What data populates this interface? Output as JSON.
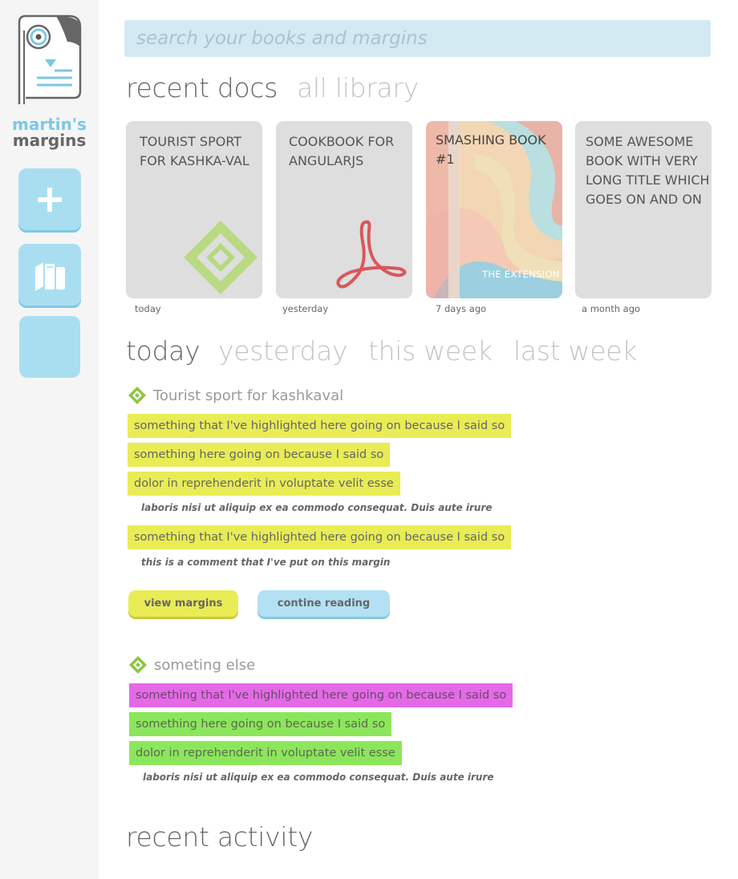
{
  "brand": {
    "line1": "martin's",
    "line2": "margins",
    "logo_icon": "monocle-page-logo"
  },
  "sidebar": {
    "buttons": [
      {
        "name": "add-button",
        "icon": "plus-icon"
      },
      {
        "name": "library-button",
        "icon": "books-icon"
      },
      {
        "name": "blank-button",
        "icon": ""
      }
    ]
  },
  "search": {
    "placeholder": "search your books and margins",
    "value": ""
  },
  "doc_tabs": {
    "recent": "recent docs",
    "all": "all library"
  },
  "recent_docs": [
    {
      "title": "TOURIST SPORT FOR KASHKA-VAL",
      "date": "today",
      "format_icon": "epub-icon"
    },
    {
      "title": "COOKBOOK FOR ANGULARJS",
      "date": "yesterday",
      "format_icon": "pdf-icon"
    },
    {
      "title": "SMASHING BOOK #1",
      "date": "7 days ago",
      "format_icon": "book-cover",
      "cover_text": "THE EXTENSION"
    },
    {
      "title": "SOME AWESOME BOOK WITH VERY LONG TITLE WHICH GOES ON AND ON",
      "date": "a month ago",
      "format_icon": ""
    }
  ],
  "period_tabs": {
    "today": "today",
    "yesterday": "yesterday",
    "this_week": "this week",
    "last_week": "last week"
  },
  "groups": [
    {
      "book": "Tourist sport for kashkaval",
      "highlights": [
        "something that I've highlighted here going on because I said so",
        "something here going on because I said so",
        "dolor in reprehenderit in voluptate velit esse",
        "something that I've highlighted here going on because I said so"
      ],
      "notes": [
        "laboris nisi ut aliquip ex ea commodo consequat. Duis aute irure",
        "this is a comment that I've put on this margin"
      ],
      "buttons": {
        "view": "view margins",
        "continue": "contine reading"
      }
    },
    {
      "book": "someting else",
      "highlights": [
        "something that I've highlighted here going on because I said so",
        "something here going on because I said so",
        "dolor in reprehenderit in voluptate velit esse"
      ],
      "notes": [
        "laboris nisi ut aliquip ex ea commodo consequat. Duis aute irure"
      ]
    }
  ],
  "activity": {
    "title": "recent activity"
  },
  "colors": {
    "accent_blue": "#a9def1",
    "highlight_yellow": "#e9ec55",
    "highlight_magenta": "#e569e7",
    "highlight_green": "#8ce65c",
    "epub_green": "#8cc63f",
    "pdf_red": "#d9534f"
  }
}
